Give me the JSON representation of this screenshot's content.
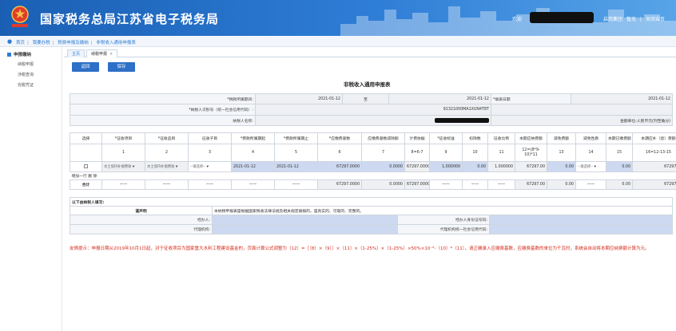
{
  "header": {
    "title": "国家税务总局江苏省电子税务局",
    "welcome": "欢迎",
    "links": [
      "启用集团",
      "暂无",
      "关闭当页"
    ],
    "emblem": "tax-emblem",
    "accent": "#1a5fb4"
  },
  "breadcrumb": {
    "items": [
      "首页",
      "我要办税",
      "税费申报及缴纳",
      "非税收入通用申报表"
    ]
  },
  "sidebar": {
    "heading": "申报缴纳",
    "items": [
      "纳税申报",
      "涉税查询",
      "完税凭证"
    ]
  },
  "tabs": [
    {
      "label": "主页",
      "active": false
    },
    {
      "label": "纳税申报",
      "active": true
    }
  ],
  "toolbar": {
    "reset_label": "返回",
    "save_label": "保存"
  },
  "form": {
    "title": "非税收入通用申报表",
    "period_label": "*税款所属期间:",
    "period_start": "2021-01-12",
    "period_to": "至",
    "period_end": "2021-01-12",
    "fill_date_label": "*填表日期",
    "fill_date": "2021-01-12",
    "taxpayer_id_label": "*纳税人识别号（统一社会信用代码）:",
    "taxpayer_id": "91321000MA1XUN4T8T",
    "taxpayer_name_label": "纳税人名称:",
    "unit_note": "金额单位:人民币元(列至角分)"
  },
  "grid": {
    "headers": [
      "选择",
      "*征收项目",
      "*征收品目",
      "征收子目",
      "*费款所属期起",
      "*费款所属期止",
      "*应缴费基数",
      "应缴费基数减除额",
      "计费依据",
      "*征收标准",
      "扣除数",
      "征收比例",
      "本期应纳费额",
      "减免费额",
      "减免性质",
      "本期已缴费额",
      "本期应补（退）费额"
    ],
    "numbers": [
      "",
      "1",
      "2",
      "3",
      "4",
      "5",
      "6",
      "7",
      "8=6-7",
      "9",
      "10",
      "11",
      "12=(8*9-10)*11",
      "13",
      "14",
      "15",
      "16=12-13-15"
    ],
    "row": {
      "item": "水土保持补偿费收",
      "subitem": "水土保持补偿费收",
      "child": "--请选择--",
      "start": "2021-01-12",
      "end": "2021-01-12",
      "base": "67297.0000",
      "deduction": "0.0000",
      "basis": "67297.0000",
      "standard": "1.000000",
      "deduct_num": "0.00",
      "ratio": "1.000000",
      "payable": "67297.00",
      "relief": "0.00",
      "relief_nature": "--请选择--",
      "paid": "0.00",
      "due": "67297.00"
    },
    "row_actions": [
      "增加一行",
      "删",
      "除"
    ],
    "total_label": "合计",
    "dash": "——",
    "total_base": "67297.0000",
    "total_deduction": "0.0000",
    "total_basis": "67297.0000",
    "total_payable": "67297.00",
    "total_relief": "0.00",
    "total_paid": "0.00",
    "total_due": "67297.00"
  },
  "declare": {
    "heading": "以下由纳税人填写:",
    "statement_label": "谨声明",
    "statement": "本纳税申报表是根据国家税收法律法规及相关规定填报的，是真实的、可靠的、完整的。",
    "handler_label": "经办人:",
    "handler_id_label": "经办人身份证号码:",
    "agent_label": "代理机构:",
    "agent_code_label": "代理机构统一社会信用代码:"
  },
  "notice": {
    "text": "友情提示：申报日期从2019年10月1日起，对于征收项目为国家重大水利工程建设基金的，页面计算公式调整为（12）=［（8）×（9）］×（11）×（1-25%）×（1-25%）×50%×10⁻⁸-（10）*（11），请正确录入应缴费基数，应缴费基数的单位为千瓦时，系统会自动将本期应纳费额计算为元。"
  }
}
